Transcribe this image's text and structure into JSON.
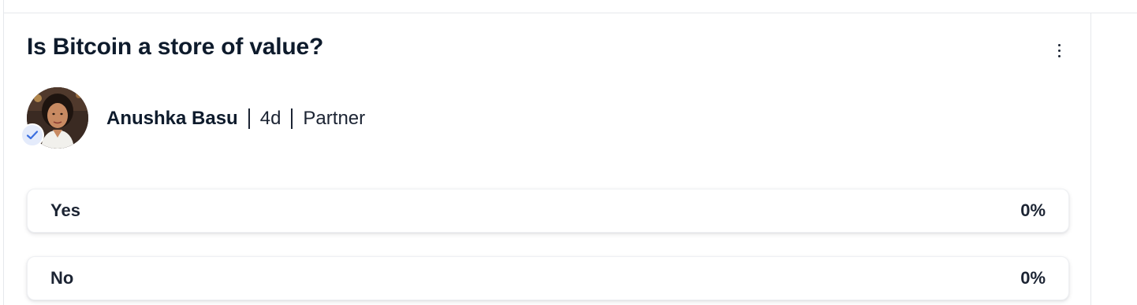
{
  "post": {
    "title": "Is Bitcoin a store of value?",
    "more_icon": "more-vertical-icon"
  },
  "author": {
    "name": "Anushka Basu",
    "time_ago": "4d",
    "role": "Partner",
    "verified_icon": "checkmark-icon"
  },
  "poll": {
    "options": [
      {
        "label": "Yes",
        "percent_text": "0%",
        "percent": 0
      },
      {
        "label": "No",
        "percent_text": "0%",
        "percent": 0
      }
    ]
  },
  "colors": {
    "text": "#0e1b2c",
    "verified_badge_bg": "#e4ebfb",
    "verified_check": "#3b6fe0",
    "divider": "#e6e8ec"
  }
}
